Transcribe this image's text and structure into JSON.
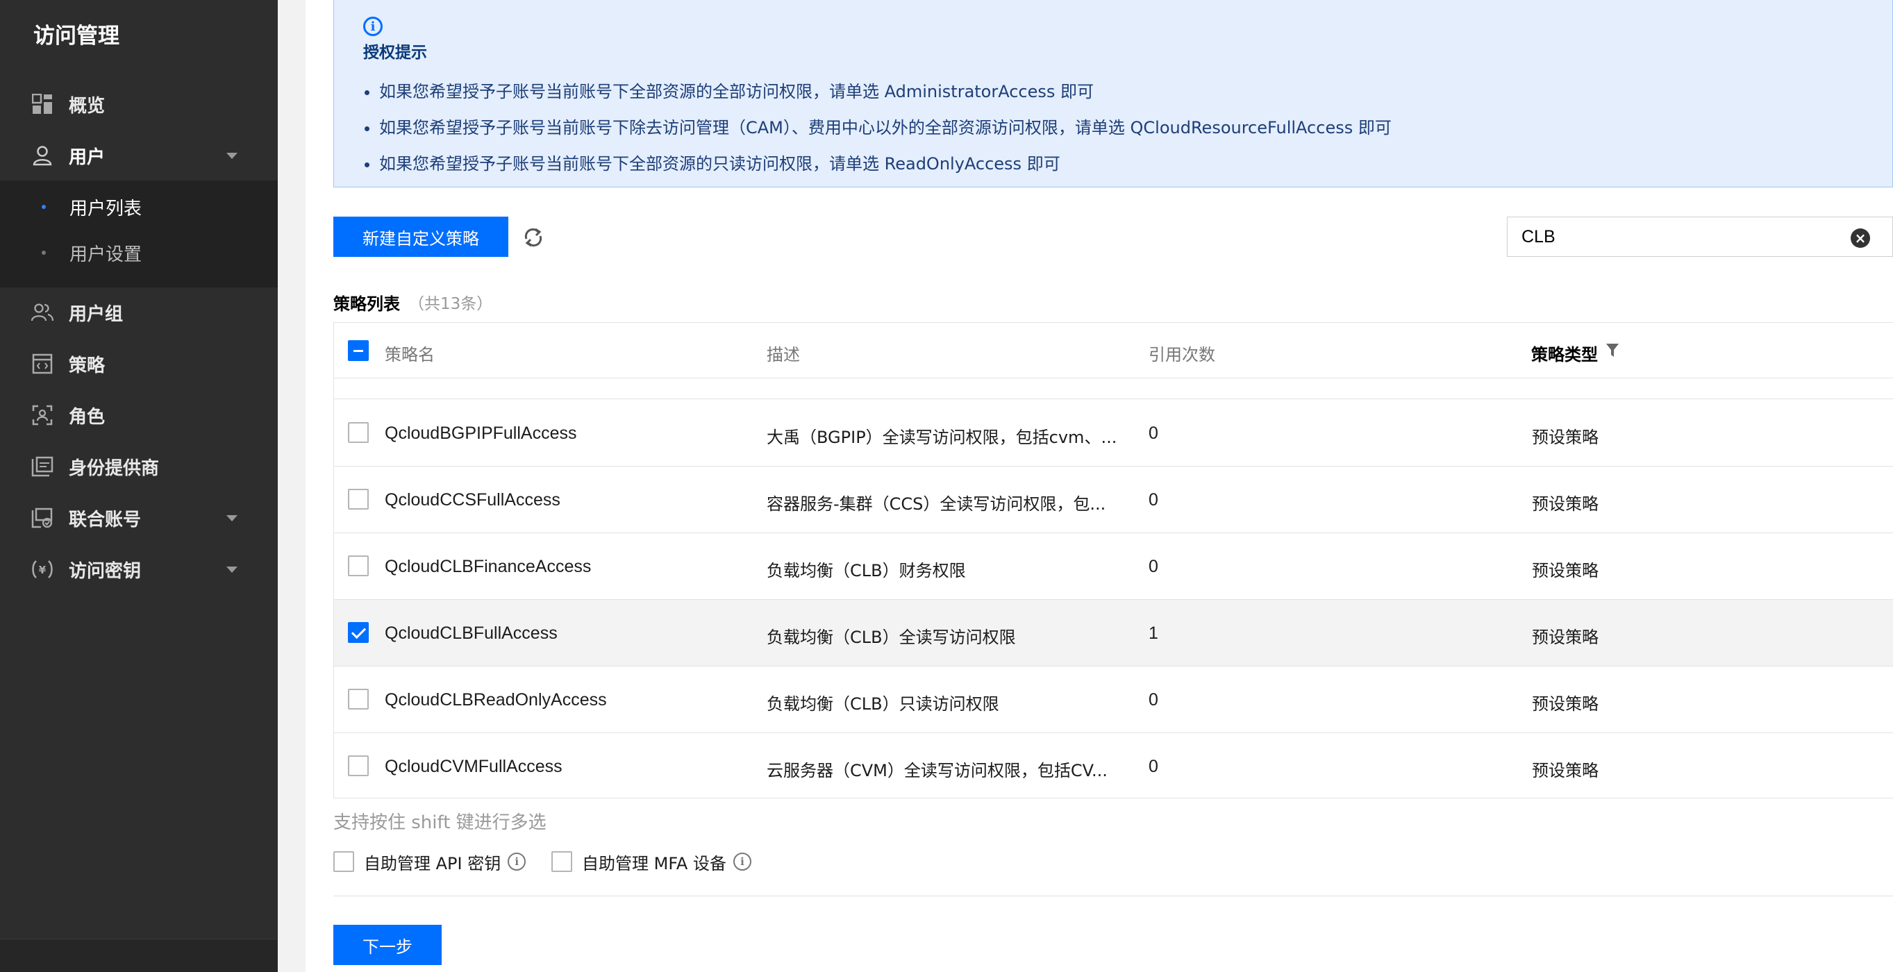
{
  "sidebar": {
    "title": "访问管理",
    "items": [
      {
        "label": "概览"
      },
      {
        "label": "用户"
      },
      {
        "label": "用户组"
      },
      {
        "label": "策略"
      },
      {
        "label": "角色"
      },
      {
        "label": "身份提供商"
      },
      {
        "label": "联合账号"
      },
      {
        "label": "访问密钥"
      }
    ],
    "submenu": [
      {
        "label": "用户列表",
        "active": true
      },
      {
        "label": "用户设置",
        "active": false
      }
    ]
  },
  "tip": {
    "title": "授权提示",
    "lines": [
      "如果您希望授予子账号当前账号下全部资源的全部访问权限，请单选 AdministratorAccess 即可",
      "如果您希望授予子账号当前账号下除去访问管理（CAM）、费用中心以外的全部资源访问权限，请单选 QCloudResourceFullAccess 即可",
      "如果您希望授予子账号当前账号下全部资源的只读访问权限，请单选 ReadOnlyAccess 即可"
    ]
  },
  "toolbar": {
    "create_label": "新建自定义策略",
    "search_value": "CLB"
  },
  "list": {
    "title": "策略列表",
    "count": "（共13条）",
    "columns": {
      "name": "策略名",
      "desc": "描述",
      "refs": "引用次数",
      "type": "策略类型"
    },
    "rows": [
      {
        "name": "QcloudBGPIPFullAccess",
        "desc": "大禹（BGPIP）全读写访问权限，包括cvm、...",
        "refs": "0",
        "type": "预设策略",
        "checked": false
      },
      {
        "name": "QcloudCCSFullAccess",
        "desc": "容器服务-集群（CCS）全读写访问权限，包...",
        "refs": "0",
        "type": "预设策略",
        "checked": false
      },
      {
        "name": "QcloudCLBFinanceAccess",
        "desc": "负载均衡（CLB）财务权限",
        "refs": "0",
        "type": "预设策略",
        "checked": false
      },
      {
        "name": "QcloudCLBFullAccess",
        "desc": "负载均衡（CLB）全读写访问权限",
        "refs": "1",
        "type": "预设策略",
        "checked": true
      },
      {
        "name": "QcloudCLBReadOnlyAccess",
        "desc": "负载均衡（CLB）只读访问权限",
        "refs": "0",
        "type": "预设策略",
        "checked": false
      },
      {
        "name": "QcloudCVMFullAccess",
        "desc": "云服务器（CVM）全读写访问权限，包括CV...",
        "refs": "0",
        "type": "预设策略",
        "checked": false
      }
    ]
  },
  "hint": "支持按住 shift 键进行多选",
  "options": [
    {
      "label": "自助管理 API 密钥"
    },
    {
      "label": "自助管理 MFA 设备"
    }
  ],
  "next_label": "下一步",
  "colors": {
    "accent": "#006eff",
    "sidebar_bg": "#2d2d2d",
    "tip_bg": "#e4eefc"
  }
}
